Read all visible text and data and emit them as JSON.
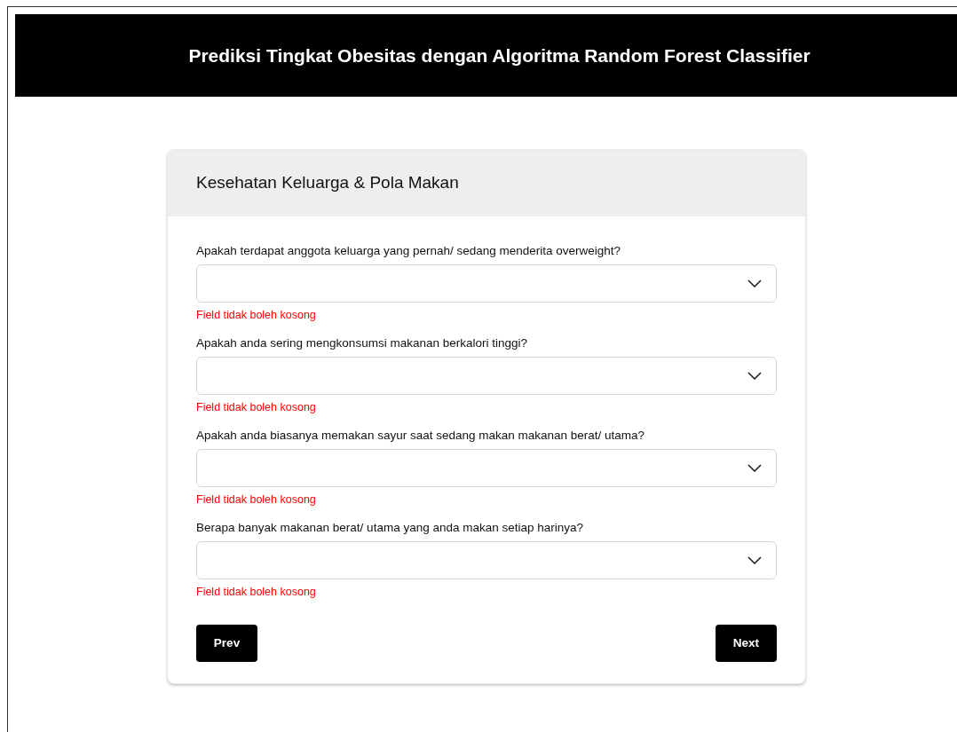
{
  "header": {
    "title": "Prediksi Tingkat Obesitas dengan Algoritma Random Forest Classifier"
  },
  "card": {
    "title": "Kesehatan Keluarga & Pola Makan",
    "questions": [
      {
        "label": "Apakah terdapat anggota keluarga yang pernah/ sedang menderita overweight?",
        "error": "Field tidak boleh kosong"
      },
      {
        "label": "Apakah anda sering mengkonsumsi makanan berkalori tinggi?",
        "error": "Field tidak boleh kosong"
      },
      {
        "label": "Apakah anda biasanya memakan sayur saat sedang makan makanan berat/ utama?",
        "error": "Field tidak boleh kosong"
      },
      {
        "label": "Berapa banyak makanan berat/ utama yang anda makan setiap harinya?",
        "error": "Field tidak boleh kosong"
      }
    ],
    "buttons": [
      {
        "label": "Prev"
      },
      {
        "label": "Next"
      }
    ]
  }
}
